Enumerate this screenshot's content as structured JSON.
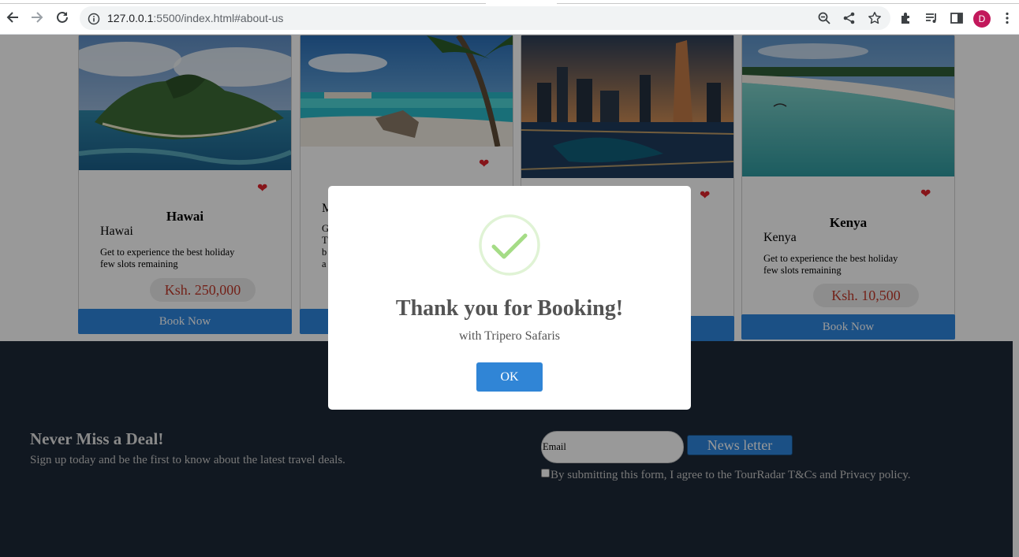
{
  "browser": {
    "url_host": "127.0.0.1",
    "url_rest": ":5500/index.html#about-us",
    "profile_initial": "D",
    "icons": [
      "back-arrow-icon",
      "forward-arrow-icon",
      "reload-icon",
      "info-icon",
      "zoom-out-icon",
      "share-icon",
      "star-icon",
      "extensions-icon",
      "media-icon",
      "side-panel-icon",
      "menu-icon"
    ]
  },
  "cards": [
    {
      "title": "Hawai",
      "subtitle": "Hawai",
      "desc1": "Get to experience the best holiday",
      "desc2": "few slots remaining",
      "price": "Ksh. 250,000",
      "button": "Book Now"
    },
    {
      "title": "",
      "subtitle": "M",
      "desc1": "G",
      "desc2": "T",
      "desc3": "b",
      "desc4": "a",
      "price": "",
      "button": ""
    },
    {
      "title": "",
      "subtitle": "",
      "desc1": "",
      "desc2": "",
      "price": "",
      "button": ""
    },
    {
      "title": "Kenya",
      "subtitle": "Kenya",
      "desc1": "Get to experience the best holiday",
      "desc2": "few slots remaining",
      "price": "Ksh. 10,500",
      "button": "Book Now"
    }
  ],
  "footer": {
    "deal_title": "Never Miss a Deal!",
    "deal_sub": "Sign up today and be the first to know about the latest travel deals.",
    "email_placeholder": "Email",
    "newsletter_button": "News letter",
    "agree_text": "By submitting this form, I agree to the TourRadar T&Cs and Privacy policy."
  },
  "modal": {
    "icon": "success-check-icon",
    "title": "Thank you for Booking!",
    "text": "with Tripero Safaris",
    "ok_label": "OK"
  },
  "colors": {
    "accent": "#2e86de",
    "footer_bg": "#1d2837",
    "heart": "#e0242c",
    "price_text": "#c0392b",
    "success": "#a5dc86"
  }
}
